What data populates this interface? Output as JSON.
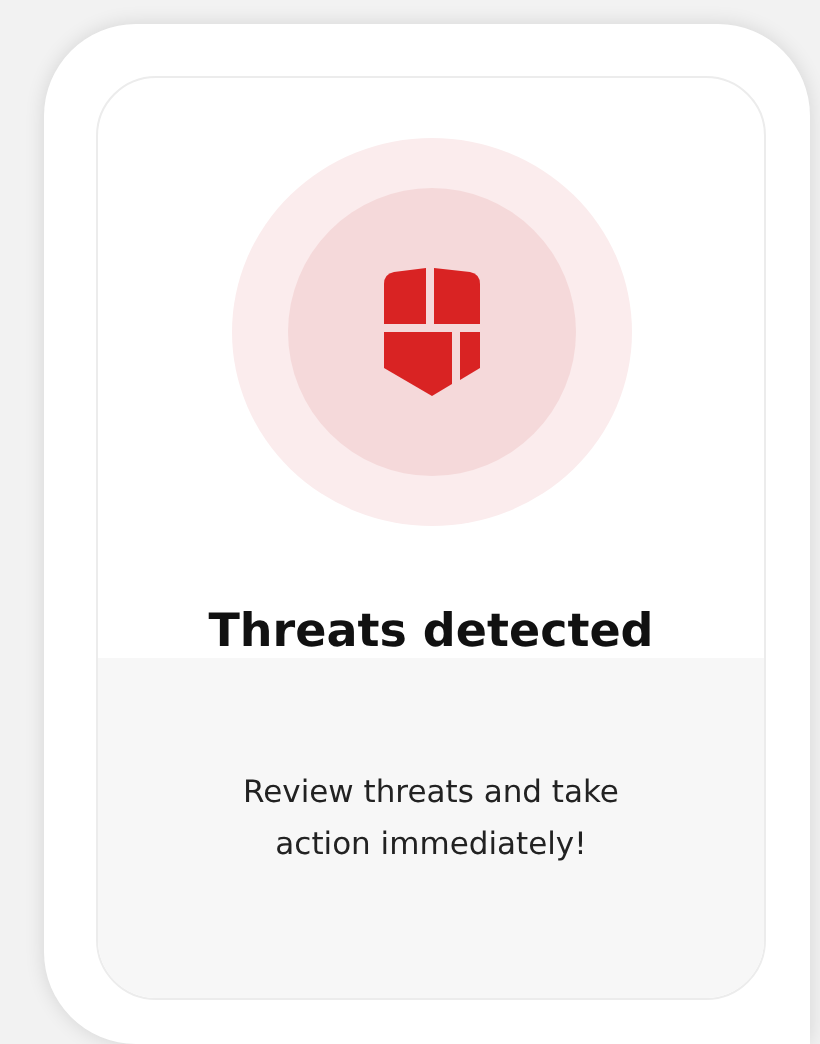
{
  "status": {
    "kind": "threat",
    "title": "Threats detected",
    "message": "Review threats and take action immediately!"
  }
}
